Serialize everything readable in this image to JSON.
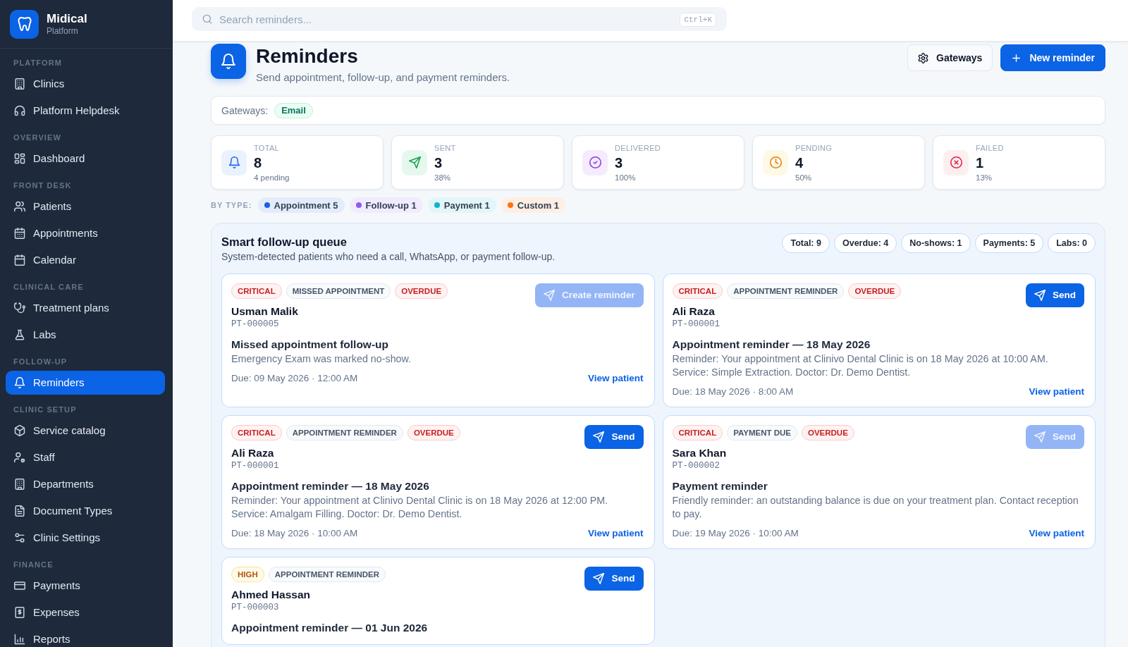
{
  "sidebar": {
    "brand": {
      "name": "Midical",
      "subtitle": "Platform"
    },
    "sections": [
      {
        "title": "PLATFORM",
        "items": [
          {
            "label": "Clinics",
            "selected": false
          },
          {
            "label": "Platform Helpdesk",
            "selected": false
          }
        ]
      },
      {
        "title": "OVERVIEW",
        "items": [
          {
            "label": "Dashboard",
            "selected": false
          }
        ]
      },
      {
        "title": "FRONT DESK",
        "items": [
          {
            "label": "Patients",
            "selected": false
          },
          {
            "label": "Appointments",
            "selected": false
          },
          {
            "label": "Calendar",
            "selected": false
          }
        ]
      },
      {
        "title": "CLINICAL CARE",
        "items": [
          {
            "label": "Treatment plans",
            "selected": false
          },
          {
            "label": "Labs",
            "selected": false
          }
        ]
      },
      {
        "title": "FOLLOW-UP",
        "items": [
          {
            "label": "Reminders",
            "selected": true
          }
        ]
      },
      {
        "title": "CLINIC SETUP",
        "items": [
          {
            "label": "Service catalog",
            "selected": false
          },
          {
            "label": "Staff",
            "selected": false
          },
          {
            "label": "Departments",
            "selected": false
          },
          {
            "label": "Document Types",
            "selected": false
          },
          {
            "label": "Clinic Settings",
            "selected": false
          }
        ]
      },
      {
        "title": "FINANCE",
        "items": [
          {
            "label": "Payments",
            "selected": false
          },
          {
            "label": "Expenses",
            "selected": false
          },
          {
            "label": "Reports",
            "selected": false
          }
        ]
      }
    ]
  },
  "search": {
    "placeholder": "Search reminders...",
    "shortcut": "Ctrl+K"
  },
  "page": {
    "title": "Reminders",
    "subtitle": "Send appointment, follow-up, and payment reminders.",
    "buttons": [
      {
        "label": "Gateways",
        "kind": "secondary"
      },
      {
        "label": "New reminder",
        "kind": "primary"
      }
    ]
  },
  "gateways": {
    "label": "Gateways:",
    "items": [
      "Email"
    ]
  },
  "stats": [
    {
      "kind": "total",
      "label": "TOTAL",
      "value": "8",
      "detail": "4 pending"
    },
    {
      "kind": "sent",
      "label": "SENT",
      "value": "3",
      "detail": "38%"
    },
    {
      "kind": "delivered",
      "label": "DELIVERED",
      "value": "3",
      "detail": "100%"
    },
    {
      "kind": "pending",
      "label": "PENDING",
      "value": "4",
      "detail": "50%"
    },
    {
      "kind": "failed",
      "label": "FAILED",
      "value": "1",
      "detail": "13%"
    }
  ],
  "by_type": {
    "label": "BY TYPE:",
    "items": [
      {
        "label": "Appointment 5",
        "color": "#1d5fe0"
      },
      {
        "label": "Follow-up 1",
        "color": "#8b5cf6"
      },
      {
        "label": "Payment 1",
        "color": "#0fb3cc"
      },
      {
        "label": "Custom 1",
        "color": "#f97316"
      }
    ]
  },
  "queue": {
    "title": "Smart follow-up queue",
    "subtitle": "System-detected patients who need a call, WhatsApp, or payment follow-up.",
    "counts": [
      "Total: 9",
      "Overdue: 4",
      "No-shows: 1",
      "Payments: 5",
      "Labs: 0"
    ],
    "cards": [
      {
        "badges": [
          {
            "text": "CRITICAL",
            "kind": "danger"
          },
          {
            "text": "MISSED APPOINTMENT",
            "kind": "neutral"
          },
          {
            "text": "OVERDUE",
            "kind": "danger"
          }
        ],
        "name": "Usman Malik",
        "patient_id": "PT-000005",
        "title": "Missed appointment follow-up",
        "message": "Emergency Exam was marked no-show.",
        "due": "Due: 09 May 2026 · 12:00 AM",
        "link": "View patient",
        "action": {
          "label": "Create reminder",
          "disabled": true
        }
      },
      {
        "badges": [
          {
            "text": "CRITICAL",
            "kind": "danger"
          },
          {
            "text": "APPOINTMENT REMINDER",
            "kind": "neutral"
          },
          {
            "text": "OVERDUE",
            "kind": "danger"
          }
        ],
        "name": "Ali Raza",
        "patient_id": "PT-000001",
        "title": "Appointment reminder — 18 May 2026",
        "message": "Reminder: Your appointment at Clinivo Dental Clinic is on 18 May 2026 at 10:00 AM. Service: Simple Extraction. Doctor: Dr. Demo Dentist.",
        "due": "Due: 18 May 2026 · 8:00 AM",
        "link": "View patient",
        "action": {
          "label": "Send",
          "disabled": false
        }
      },
      {
        "badges": [
          {
            "text": "CRITICAL",
            "kind": "danger"
          },
          {
            "text": "APPOINTMENT REMINDER",
            "kind": "neutral"
          },
          {
            "text": "OVERDUE",
            "kind": "danger"
          }
        ],
        "name": "Ali Raza",
        "patient_id": "PT-000001",
        "title": "Appointment reminder — 18 May 2026",
        "message": "Reminder: Your appointment at Clinivo Dental Clinic is on 18 May 2026 at 12:00 PM. Service: Amalgam Filling. Doctor: Dr. Demo Dentist.",
        "due": "Due: 18 May 2026 · 10:00 AM",
        "link": "View patient",
        "action": {
          "label": "Send",
          "disabled": false
        }
      },
      {
        "badges": [
          {
            "text": "CRITICAL",
            "kind": "danger"
          },
          {
            "text": "PAYMENT DUE",
            "kind": "neutral"
          },
          {
            "text": "OVERDUE",
            "kind": "danger"
          }
        ],
        "name": "Sara Khan",
        "patient_id": "PT-000002",
        "title": "Payment reminder",
        "message": "Friendly reminder: an outstanding balance is due on your treatment plan. Contact reception to pay.",
        "due": "Due: 19 May 2026 · 10:00 AM",
        "link": "View patient",
        "action": {
          "label": "Send",
          "disabled": true
        }
      },
      {
        "badges": [
          {
            "text": "HIGH",
            "kind": "warning"
          },
          {
            "text": "APPOINTMENT REMINDER",
            "kind": "neutral"
          }
        ],
        "name": "Ahmed Hassan",
        "patient_id": "PT-000003",
        "title": "Appointment reminder — 01 Jun 2026",
        "action": {
          "label": "Send",
          "disabled": false
        }
      }
    ]
  }
}
